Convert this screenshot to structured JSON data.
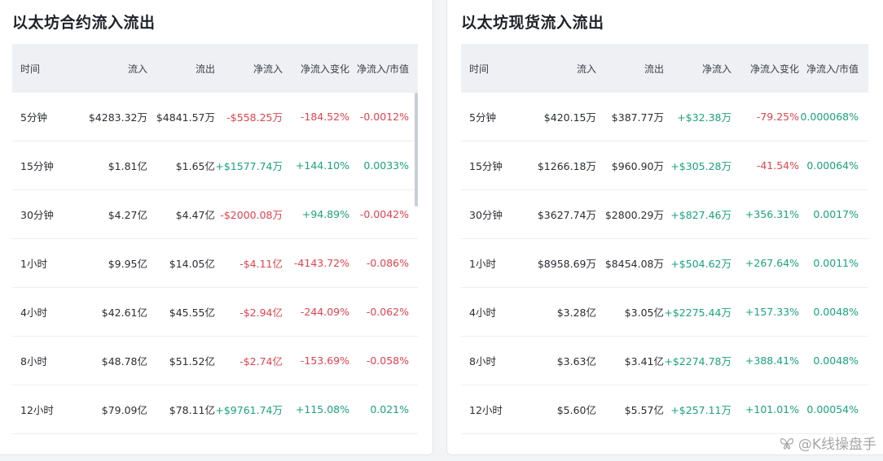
{
  "futures": {
    "title": "以太坊合约流入流出",
    "headers": [
      "时间",
      "流入",
      "流出",
      "净流入",
      "净流入变化",
      "净流入/市值"
    ],
    "rows": [
      {
        "cells": [
          "5分钟",
          "$4283.32万",
          "$4841.57万",
          "-$558.25万",
          "-184.52%",
          "-0.0012%"
        ],
        "signs": [
          "",
          "",
          "",
          "neg",
          "neg",
          "neg"
        ]
      },
      {
        "cells": [
          "15分钟",
          "$1.81亿",
          "$1.65亿",
          "+$1577.74万",
          "+144.10%",
          "0.0033%"
        ],
        "signs": [
          "",
          "",
          "",
          "pos",
          "pos",
          "pos"
        ]
      },
      {
        "cells": [
          "30分钟",
          "$4.27亿",
          "$4.47亿",
          "-$2000.08万",
          "+94.89%",
          "-0.0042%"
        ],
        "signs": [
          "",
          "",
          "",
          "neg",
          "pos",
          "neg"
        ]
      },
      {
        "cells": [
          "1小时",
          "$9.95亿",
          "$14.05亿",
          "-$4.11亿",
          "-4143.72%",
          "-0.086%"
        ],
        "signs": [
          "",
          "",
          "",
          "neg",
          "neg",
          "neg"
        ]
      },
      {
        "cells": [
          "4小时",
          "$42.61亿",
          "$45.55亿",
          "-$2.94亿",
          "-244.09%",
          "-0.062%"
        ],
        "signs": [
          "",
          "",
          "",
          "neg",
          "neg",
          "neg"
        ]
      },
      {
        "cells": [
          "8小时",
          "$48.78亿",
          "$51.52亿",
          "-$2.74亿",
          "-153.69%",
          "-0.058%"
        ],
        "signs": [
          "",
          "",
          "",
          "neg",
          "neg",
          "neg"
        ]
      },
      {
        "cells": [
          "12小时",
          "$79.09亿",
          "$78.11亿",
          "+$9761.74万",
          "+115.08%",
          "0.021%"
        ],
        "signs": [
          "",
          "",
          "",
          "pos",
          "pos",
          "pos"
        ]
      }
    ]
  },
  "spot": {
    "title": "以太坊现货流入流出",
    "headers": [
      "时间",
      "流入",
      "流出",
      "净流入",
      "净流入变化",
      "净流入/市值"
    ],
    "rows": [
      {
        "cells": [
          "5分钟",
          "$420.15万",
          "$387.77万",
          "+$32.38万",
          "-79.25%",
          "0.000068%"
        ],
        "signs": [
          "",
          "",
          "",
          "pos",
          "neg",
          "pos"
        ]
      },
      {
        "cells": [
          "15分钟",
          "$1266.18万",
          "$960.90万",
          "+$305.28万",
          "-41.54%",
          "0.00064%"
        ],
        "signs": [
          "",
          "",
          "",
          "pos",
          "neg",
          "pos"
        ]
      },
      {
        "cells": [
          "30分钟",
          "$3627.74万",
          "$2800.29万",
          "+$827.46万",
          "+356.31%",
          "0.0017%"
        ],
        "signs": [
          "",
          "",
          "",
          "pos",
          "pos",
          "pos"
        ]
      },
      {
        "cells": [
          "1小时",
          "$8958.69万",
          "$8454.08万",
          "+$504.62万",
          "+267.64%",
          "0.0011%"
        ],
        "signs": [
          "",
          "",
          "",
          "pos",
          "pos",
          "pos"
        ]
      },
      {
        "cells": [
          "4小时",
          "$3.28亿",
          "$3.05亿",
          "+$2275.44万",
          "+157.33%",
          "0.0048%"
        ],
        "signs": [
          "",
          "",
          "",
          "pos",
          "pos",
          "pos"
        ]
      },
      {
        "cells": [
          "8小时",
          "$3.63亿",
          "$3.41亿",
          "+$2274.78万",
          "+388.41%",
          "0.0048%"
        ],
        "signs": [
          "",
          "",
          "",
          "pos",
          "pos",
          "pos"
        ]
      },
      {
        "cells": [
          "12小时",
          "$5.60亿",
          "$5.57亿",
          "+$257.11万",
          "+101.01%",
          "0.00054%"
        ],
        "signs": [
          "",
          "",
          "",
          "pos",
          "pos",
          "pos"
        ]
      }
    ]
  },
  "colors": {
    "positive": "#1aa37b",
    "negative": "#e5414d"
  },
  "watermark": {
    "icon": "butterfly-icon",
    "text": "@K线操盘手"
  }
}
